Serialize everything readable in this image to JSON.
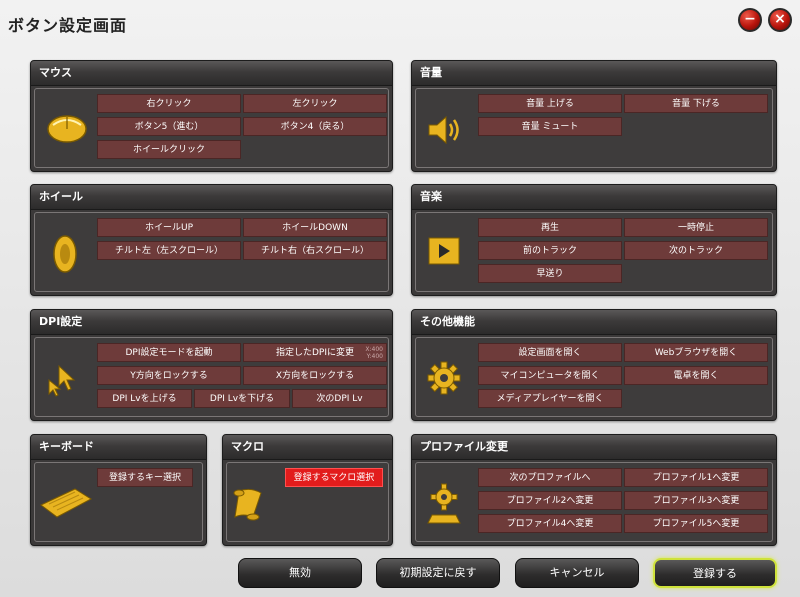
{
  "window": {
    "title": "ボタン設定画面"
  },
  "panels": {
    "mouse": {
      "title": "マウス",
      "buttons": [
        "右クリック",
        "左クリック",
        "ボタン5（進む）",
        "ボタン4（戻る）",
        "ホイールクリック"
      ]
    },
    "volume": {
      "title": "音量",
      "buttons": [
        "音量 上げる",
        "音量 下げる",
        "音量 ミュート"
      ]
    },
    "wheel": {
      "title": "ホイール",
      "buttons": [
        "ホイールUP",
        "ホイールDOWN",
        "チルト左（左スクロール）",
        "チルト右（右スクロール）"
      ]
    },
    "music": {
      "title": "音楽",
      "buttons": [
        "再生",
        "一時停止",
        "前のトラック",
        "次のトラック",
        "早送り"
      ]
    },
    "dpi": {
      "title": "DPI設定",
      "buttons": [
        "DPI設定モードを起動",
        "指定したDPIに変更",
        "Y方向をロックする",
        "X方向をロックする",
        "DPI Lvを上げる",
        "DPI Lvを下げる",
        "次のDPI Lv"
      ],
      "note_x": "X:400",
      "note_y": "Y:400"
    },
    "other": {
      "title": "その他機能",
      "buttons": [
        "設定画面を開く",
        "Webブラウザを開く",
        "マイコンピュータを開く",
        "電卓を開く",
        "メディアプレイヤーを開く"
      ]
    },
    "keyboard": {
      "title": "キーボード",
      "buttons": [
        "登録するキー選択"
      ]
    },
    "macro": {
      "title": "マクロ",
      "buttons": [
        "登録するマクロ選択"
      ]
    },
    "profile": {
      "title": "プロファイル変更",
      "buttons": [
        "次のプロファイルへ",
        "プロファイル1へ変更",
        "プロファイル2へ変更",
        "プロファイル3へ変更",
        "プロファイル4へ変更",
        "プロファイル5へ変更"
      ]
    }
  },
  "bottom": {
    "disable": "無効",
    "reset": "初期設定に戻す",
    "cancel": "キャンセル",
    "register": "登録する"
  },
  "colors": {
    "button": "#6e3b3a",
    "selected": "#e21c1c",
    "panel": "#3b3939",
    "accent": "#d4a017",
    "highlight": "#cfe23a"
  }
}
